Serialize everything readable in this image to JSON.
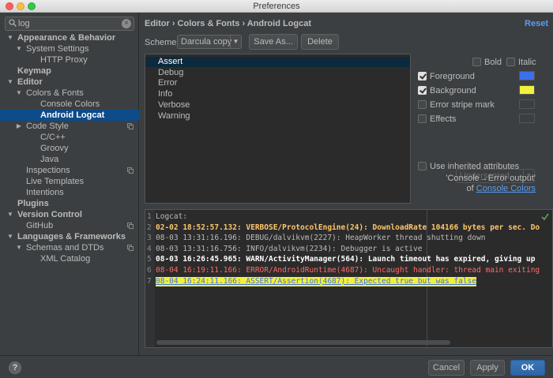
{
  "window": {
    "title": "Preferences"
  },
  "search": {
    "value": "log"
  },
  "tree": [
    {
      "label": "Appearance & Behavior",
      "indent": 0,
      "arrow": "▼",
      "bold": true
    },
    {
      "label": "System Settings",
      "indent": 1,
      "arrow": "▼"
    },
    {
      "label": "HTTP Proxy",
      "indent": 2
    },
    {
      "label": "Keymap",
      "indent": 0,
      "bold": true
    },
    {
      "label": "Editor",
      "indent": 0,
      "arrow": "▼",
      "bold": true
    },
    {
      "label": "Colors & Fonts",
      "indent": 1,
      "arrow": "▼"
    },
    {
      "label": "Console Colors",
      "indent": 2
    },
    {
      "label": "Android Logcat",
      "indent": 2,
      "selected": true,
      "bold": true
    },
    {
      "label": "Code Style",
      "indent": 1,
      "arrow": "▶",
      "copy": true
    },
    {
      "label": "C/C++",
      "indent": 2
    },
    {
      "label": "Groovy",
      "indent": 2
    },
    {
      "label": "Java",
      "indent": 2
    },
    {
      "label": "Inspections",
      "indent": 1,
      "copy": true
    },
    {
      "label": "Live Templates",
      "indent": 1
    },
    {
      "label": "Intentions",
      "indent": 1
    },
    {
      "label": "Plugins",
      "indent": 0,
      "bold": true
    },
    {
      "label": "Version Control",
      "indent": 0,
      "arrow": "▼",
      "bold": true
    },
    {
      "label": "GitHub",
      "indent": 1,
      "copy": true
    },
    {
      "label": "Languages & Frameworks",
      "indent": 0,
      "arrow": "▼",
      "bold": true
    },
    {
      "label": "Schemas and DTDs",
      "indent": 1,
      "arrow": "▼",
      "copy": true
    },
    {
      "label": "XML Catalog",
      "indent": 2
    }
  ],
  "header": {
    "breadcrumb": "Editor › Colors & Fonts › Android Logcat",
    "reset": "Reset"
  },
  "scheme": {
    "label": "Scheme:",
    "value": "Darcula copy",
    "save_as": "Save As...",
    "delete": "Delete"
  },
  "levels": [
    {
      "label": "Assert",
      "selected": true
    },
    {
      "label": "Debug"
    },
    {
      "label": "Error"
    },
    {
      "label": "Info"
    },
    {
      "label": "Verbose"
    },
    {
      "label": "Warning"
    }
  ],
  "attributes": {
    "bold": "Bold",
    "italic": "Italic",
    "foreground": {
      "label": "Foreground",
      "checked": true,
      "color": "#3d6fe8"
    },
    "background": {
      "label": "Background",
      "checked": true,
      "color": "#f2f03a"
    },
    "error_stripe": {
      "label": "Error stripe mark",
      "checked": false
    },
    "effects": {
      "label": "Effects",
      "checked": false,
      "value": "Underscored"
    },
    "inherit": {
      "label": "Use inherited attributes",
      "checked": false,
      "note": "'Console→Error output'",
      "of": "of",
      "link": "Console Colors"
    }
  },
  "preview": [
    {
      "n": "1",
      "text": "Logcat:",
      "color": "#bbbbbb"
    },
    {
      "n": "2",
      "text": "02-02 18:52:57.132: VERBOSE/ProtocolEngine(24): DownloadRate 104166 bytes per sec. Do",
      "color": "#ffc66d",
      "bold": true
    },
    {
      "n": "3",
      "text": "08-03 13:31:16.196: DEBUG/dalvikvm(2227): HeapWorker thread shutting down",
      "color": "#bbbbbb"
    },
    {
      "n": "4",
      "text": "08-03 13:31:16.756: INFO/dalvikvm(2234): Debugger is active",
      "color": "#bbbbbb"
    },
    {
      "n": "5",
      "text": "08-03 16:26:45.965: WARN/ActivityManager(564): Launch timeout has expired, giving up",
      "color": "#ffffff",
      "bold": true
    },
    {
      "n": "6",
      "text": "08-04 16:19:11.166: ERROR/AndroidRuntime(4687): Uncaught handler: thread main exiting",
      "color": "#ff6b68"
    },
    {
      "n": "7",
      "text": "08-04 16:24:11.166: ASSERT/Assertion(4687): Expected true but was false",
      "color": "#3d6fe8",
      "bg": "#f2f03a",
      "underline": true
    }
  ],
  "footer": {
    "help": "?",
    "cancel": "Cancel",
    "apply": "Apply",
    "ok": "OK"
  }
}
